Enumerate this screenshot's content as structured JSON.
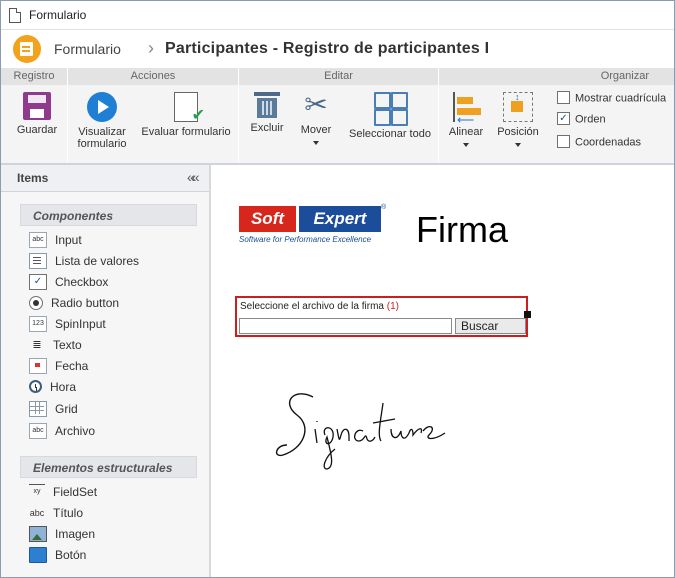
{
  "window": {
    "title": "Formulario"
  },
  "header": {
    "app_label": "Formulario",
    "separator": "›",
    "page_title": "Participantes - Registro de participantes I"
  },
  "ribbon": {
    "groups": {
      "registro": "Registro",
      "acciones": "Acciones",
      "editar": "Editar",
      "organizar": "Organizar"
    },
    "buttons": {
      "guardar": "Guardar",
      "visualizar_line1": "Visualizar",
      "visualizar_line2": "formulario",
      "evaluar": "Evaluar formulario",
      "excluir": "Excluir",
      "mover": "Mover",
      "seleccionar": "Seleccionar todo",
      "alinear": "Alinear",
      "posicion": "Posición"
    },
    "checks": {
      "mostrar": {
        "label": "Mostrar cuadrícula",
        "checked": false
      },
      "orden": {
        "label": "Orden",
        "checked": true
      },
      "coordenadas": {
        "label": "Coordenadas",
        "checked": false
      }
    }
  },
  "sidebar": {
    "title": "Items",
    "collapse_glyph": "««",
    "componentes": {
      "title": "Componentes",
      "items": [
        "Input",
        "Lista de valores",
        "Checkbox",
        "Radio button",
        "SpinInput",
        "Texto",
        "Fecha",
        "Hora",
        "Grid",
        "Archivo"
      ]
    },
    "estructurales": {
      "title": "Elementos estructurales",
      "items": [
        "FieldSet",
        "Título",
        "Imagen",
        "Botón"
      ]
    },
    "icon_glyphs": {
      "input": "abc",
      "spin": "123",
      "archivo": "abc",
      "fieldset": "xy",
      "titulo": "abc"
    }
  },
  "canvas": {
    "logo": {
      "soft": "Soft",
      "expert": "Expert",
      "reg": "®",
      "tagline": "Software for Performance Excellence"
    },
    "heading": "Firma",
    "signature_field": {
      "label": "Seleccione el archivo de la firma",
      "required_marker": "(1)",
      "button": "Buscar",
      "value": ""
    }
  }
}
